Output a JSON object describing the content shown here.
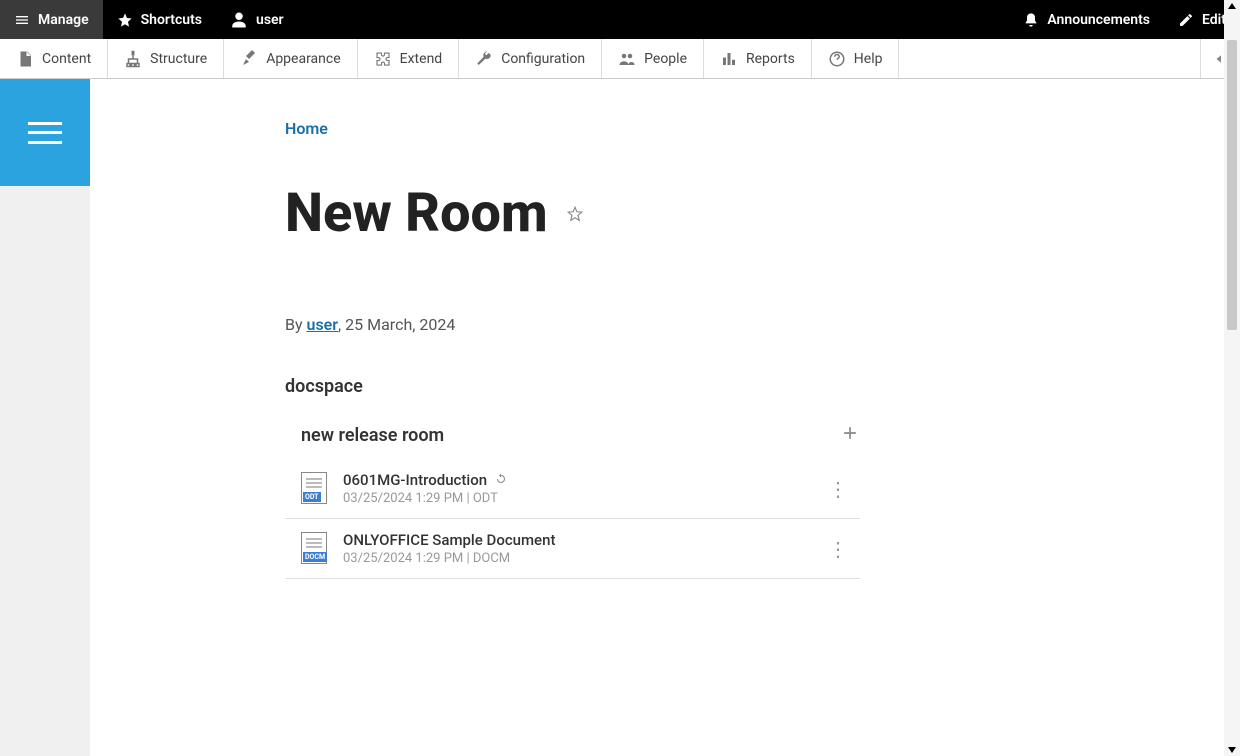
{
  "topbar": {
    "manage": "Manage",
    "shortcuts": "Shortcuts",
    "user": "user",
    "announcements": "Announcements",
    "edit": "Edit"
  },
  "adminbar": {
    "content": "Content",
    "structure": "Structure",
    "appearance": "Appearance",
    "extend": "Extend",
    "configuration": "Configuration",
    "people": "People",
    "reports": "Reports",
    "help": "Help"
  },
  "breadcrumb": {
    "home": "Home"
  },
  "page": {
    "title": "New Room",
    "by": "By ",
    "author": "user",
    "date": ", 25 March, 2024",
    "section": "docspace"
  },
  "room": {
    "title": "new release room",
    "files": [
      {
        "name": "0601MG-Introduction",
        "meta": "03/25/2024 1:29 PM | ODT",
        "type": "ODT",
        "sync": true
      },
      {
        "name": "ONLYOFFICE Sample Document",
        "meta": "03/25/2024 1:29 PM | DOCM",
        "type": "DOCM",
        "sync": false
      }
    ]
  }
}
